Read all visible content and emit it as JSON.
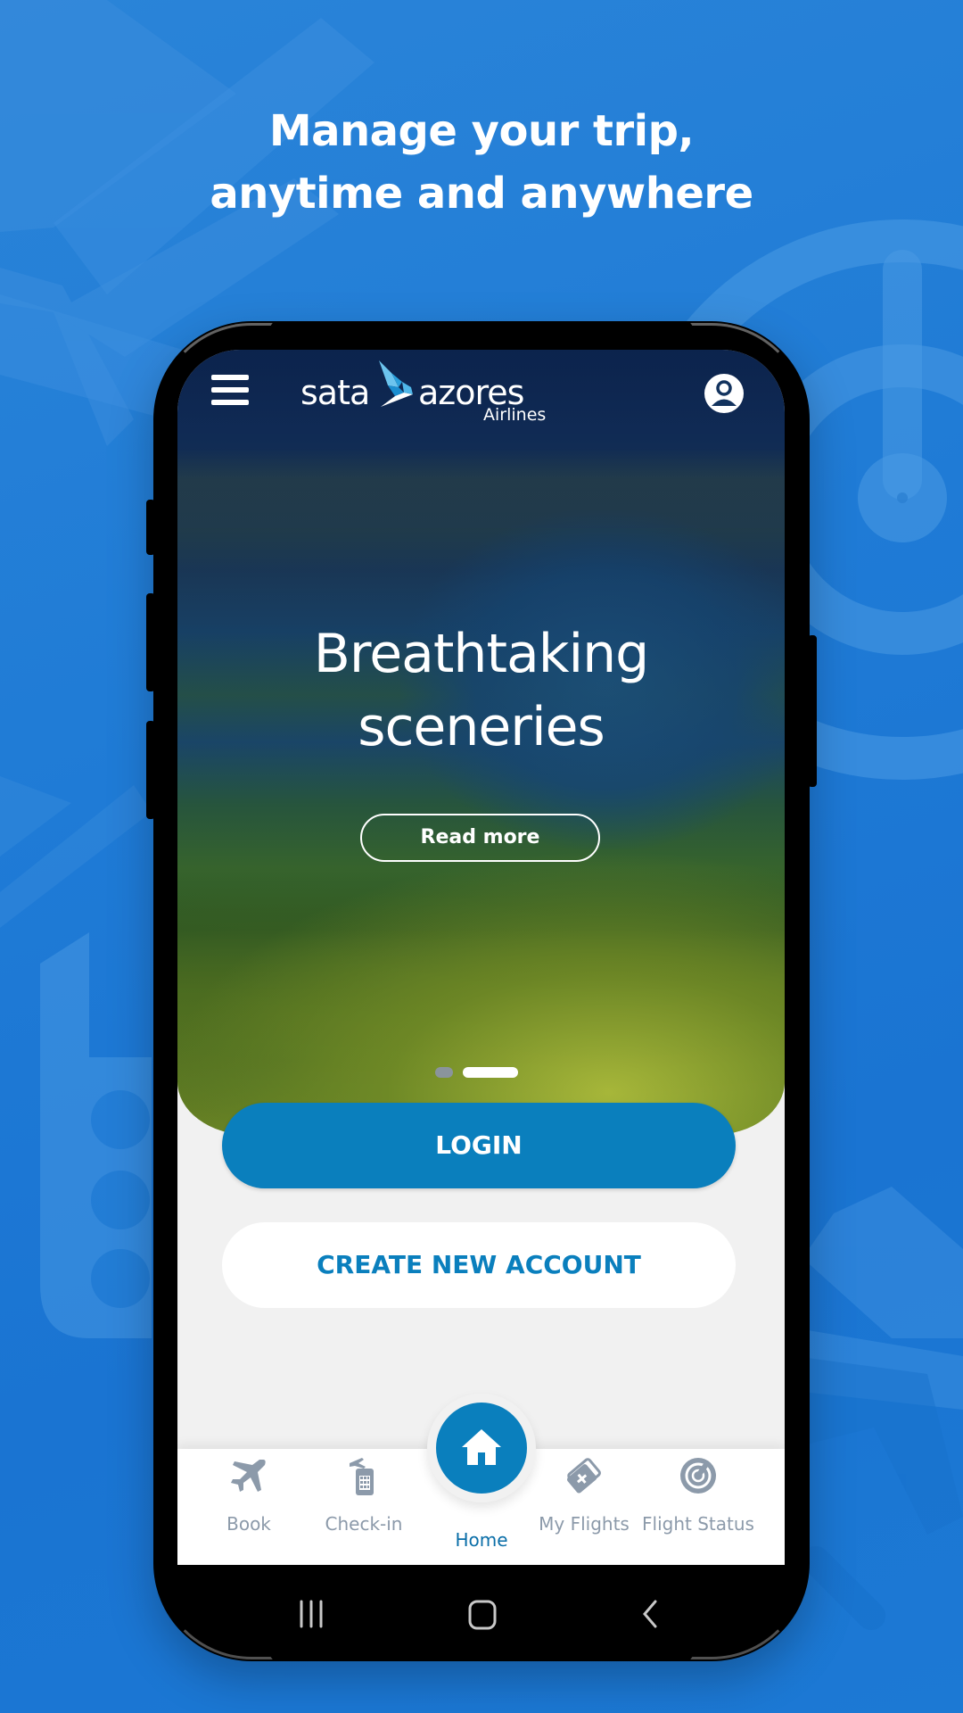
{
  "promo": {
    "headline_line1": "Manage your trip,",
    "headline_line2": "anytime and anywhere"
  },
  "app": {
    "brand": {
      "wordmark_left": "sata",
      "wordmark_right": "azores",
      "subtitle": "Airlines",
      "logo_icon": "bird-icon"
    },
    "header": {
      "menu_icon": "hamburger-menu-icon",
      "profile_icon": "user-profile-icon"
    },
    "hero": {
      "title_line1": "Breathtaking",
      "title_line2": "sceneries",
      "cta_label": "Read more",
      "carousel": {
        "total_slides": 2,
        "active_slide": 2
      }
    },
    "actions": {
      "login_label": "LOGIN",
      "create_account_label": "CREATE NEW ACCOUNT"
    },
    "bottom_nav": {
      "items": [
        {
          "label": "Book",
          "icon": "airplane-icon",
          "active": false
        },
        {
          "label": "Check-in",
          "icon": "mobile-checkin-icon",
          "active": false
        },
        {
          "label": "Home",
          "icon": "home-icon",
          "active": true
        },
        {
          "label": "My Flights",
          "icon": "boarding-pass-icon",
          "active": false
        },
        {
          "label": "Flight Status",
          "icon": "radar-icon",
          "active": false
        }
      ]
    }
  },
  "system_nav": {
    "recent_icon": "recent-apps-icon",
    "home_icon": "home-button-icon",
    "back_icon": "back-icon"
  },
  "colors": {
    "background_blue": "#1f7bd6",
    "brand_blue": "#0a7fbd",
    "nav_inactive": "#8c9aaa",
    "nav_active": "#0a6ea8",
    "screen_bg": "#f1f1f1"
  }
}
